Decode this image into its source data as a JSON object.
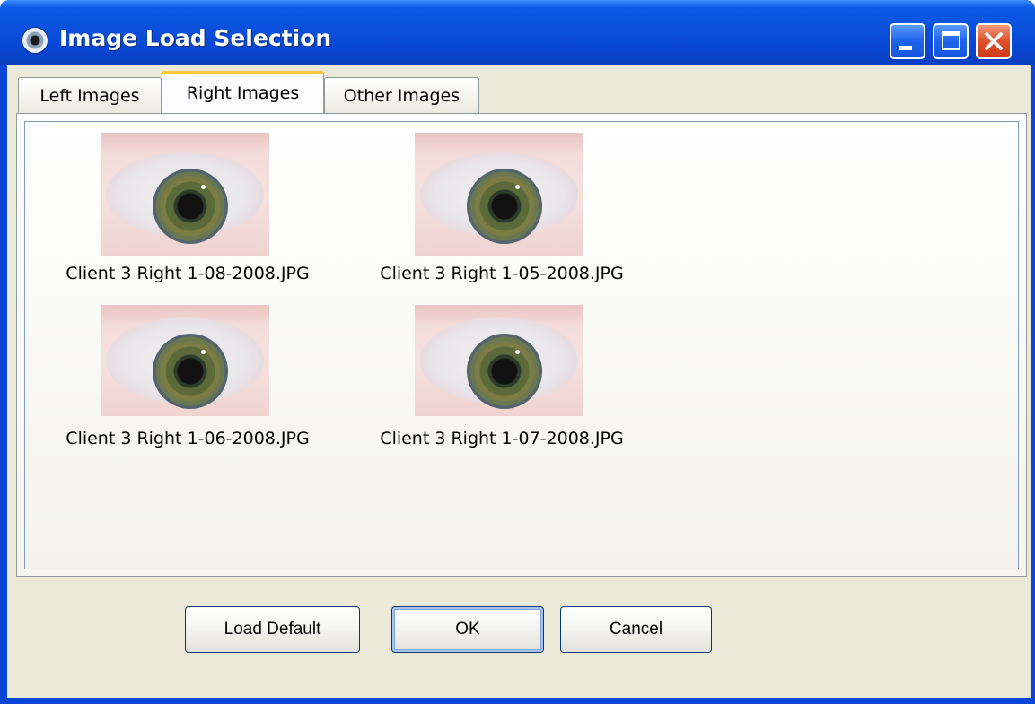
{
  "window": {
    "title": "Image Load Selection",
    "title_icon": "eye-app-icon",
    "controls": [
      "minimize-icon",
      "maximize-icon",
      "close-icon"
    ],
    "colors": {
      "titlebar": "#0a52de",
      "client": "#ece9d8",
      "active_tab_accent": "#ffc83c",
      "close_button": "#e2542e"
    }
  },
  "tabs": [
    {
      "label": "Left Images",
      "active": false
    },
    {
      "label": "Right Images",
      "active": true
    },
    {
      "label": "Other Images",
      "active": false
    }
  ],
  "images": [
    {
      "filename": "Client 3 Right 1-08-2008.JPG"
    },
    {
      "filename": "Client 3 Right 1-05-2008.JPG"
    },
    {
      "filename": "Client 3 Right 1-06-2008.JPG"
    },
    {
      "filename": "Client 3 Right 1-07-2008.JPG"
    }
  ],
  "buttons": {
    "load_default": "Load Default",
    "ok": "OK",
    "cancel": "Cancel"
  }
}
